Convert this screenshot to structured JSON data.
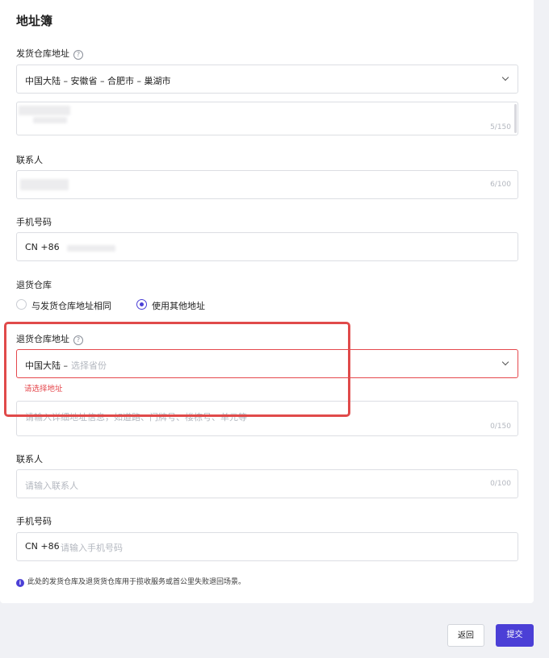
{
  "page": {
    "title": "地址簿"
  },
  "ship": {
    "address_label": "发货仓库地址",
    "region_value": "中国大陆 – 安徽省 – 合肥市 – 巢湖市",
    "detail_count": "5/150",
    "contact_label": "联系人",
    "contact_count": "6/100",
    "phone_label": "手机号码",
    "phone_prefix": "CN +86"
  },
  "returns": {
    "warehouse_label": "退货仓库",
    "options": [
      {
        "label": "与发货仓库地址相同",
        "selected": false
      },
      {
        "label": "使用其他地址",
        "selected": true
      }
    ],
    "address_label": "退货仓库地址",
    "region_prefix": "中国大陆 –",
    "region_placeholder": "选择省份",
    "region_error": "请选择地址",
    "detail_placeholder": "请输入详细地址信息，如道路、门牌号、楼栋号、单元等",
    "detail_count": "0/150",
    "contact_label": "联系人",
    "contact_placeholder": "请输入联系人",
    "contact_count": "0/100",
    "phone_label": "手机号码",
    "phone_prefix": "CN +86",
    "phone_placeholder": "请输入手机号码"
  },
  "note": "此处的发货仓库及退货货仓库用于揽收服务或首公里失败退回场景。",
  "buttons": {
    "back": "返回",
    "submit": "提交"
  },
  "colors": {
    "accent": "#4b3fd6",
    "error": "#e5484d",
    "highlight": "#e04a4a"
  },
  "icons": {
    "help": "question-circle-icon",
    "dropdown": "chevron-down-icon",
    "info": "info-circle-icon"
  }
}
